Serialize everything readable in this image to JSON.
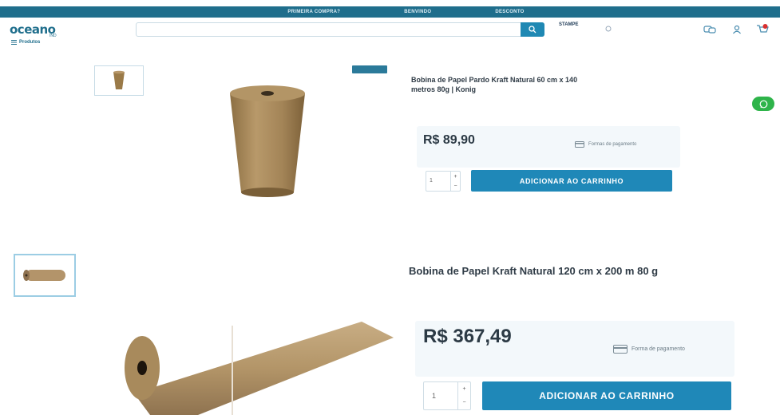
{
  "topbar": {
    "left_faint": "",
    "promo_first": "PRIMEIRA COMPRA?",
    "mid_faint": "",
    "welcome": "BENVINDO",
    "right_faint": "",
    "discount": "DESCONTO"
  },
  "header": {
    "logo": "oceano",
    "logo_sub": "IND",
    "search_placeholder": "",
    "promo_title": "STAMPE",
    "promo_sub": "",
    "delivery_text": ""
  },
  "nav": {
    "products_label": "Produtos",
    "items": [
      "",
      "",
      "",
      "",
      "",
      "",
      "",
      "",
      "",
      "",
      "",
      ""
    ]
  },
  "product1": {
    "badge": "",
    "title_line1": "Bobina de Papel Pardo Kraft Natural 60 cm x 140",
    "title_line2": "metros 80g | Konig",
    "meta1": "",
    "meta2": "",
    "price_label": "",
    "price": "R$ 89,90",
    "installments": "",
    "pix": "",
    "payment_label": "Formas de pagamento",
    "qty": "1",
    "cart_label": "ADICIONAR AO CARRINHO"
  },
  "product2": {
    "breadcrumb": "",
    "title": "Bobina de Papel Kraft Natural 120 cm x 200 m 80 g",
    "meta1": "",
    "meta2": "",
    "price": "R$ 367,49",
    "installments": "",
    "pix": "",
    "payment_label": "Forma de pagamento",
    "qty": "1",
    "cart_label": "ADICIONAR AO CARRINHO"
  },
  "colors": {
    "brand": "#1f6e8c",
    "cart_button": "#1f88b8",
    "whatsapp": "#2eb44a",
    "kraft": "#a88a5c"
  }
}
